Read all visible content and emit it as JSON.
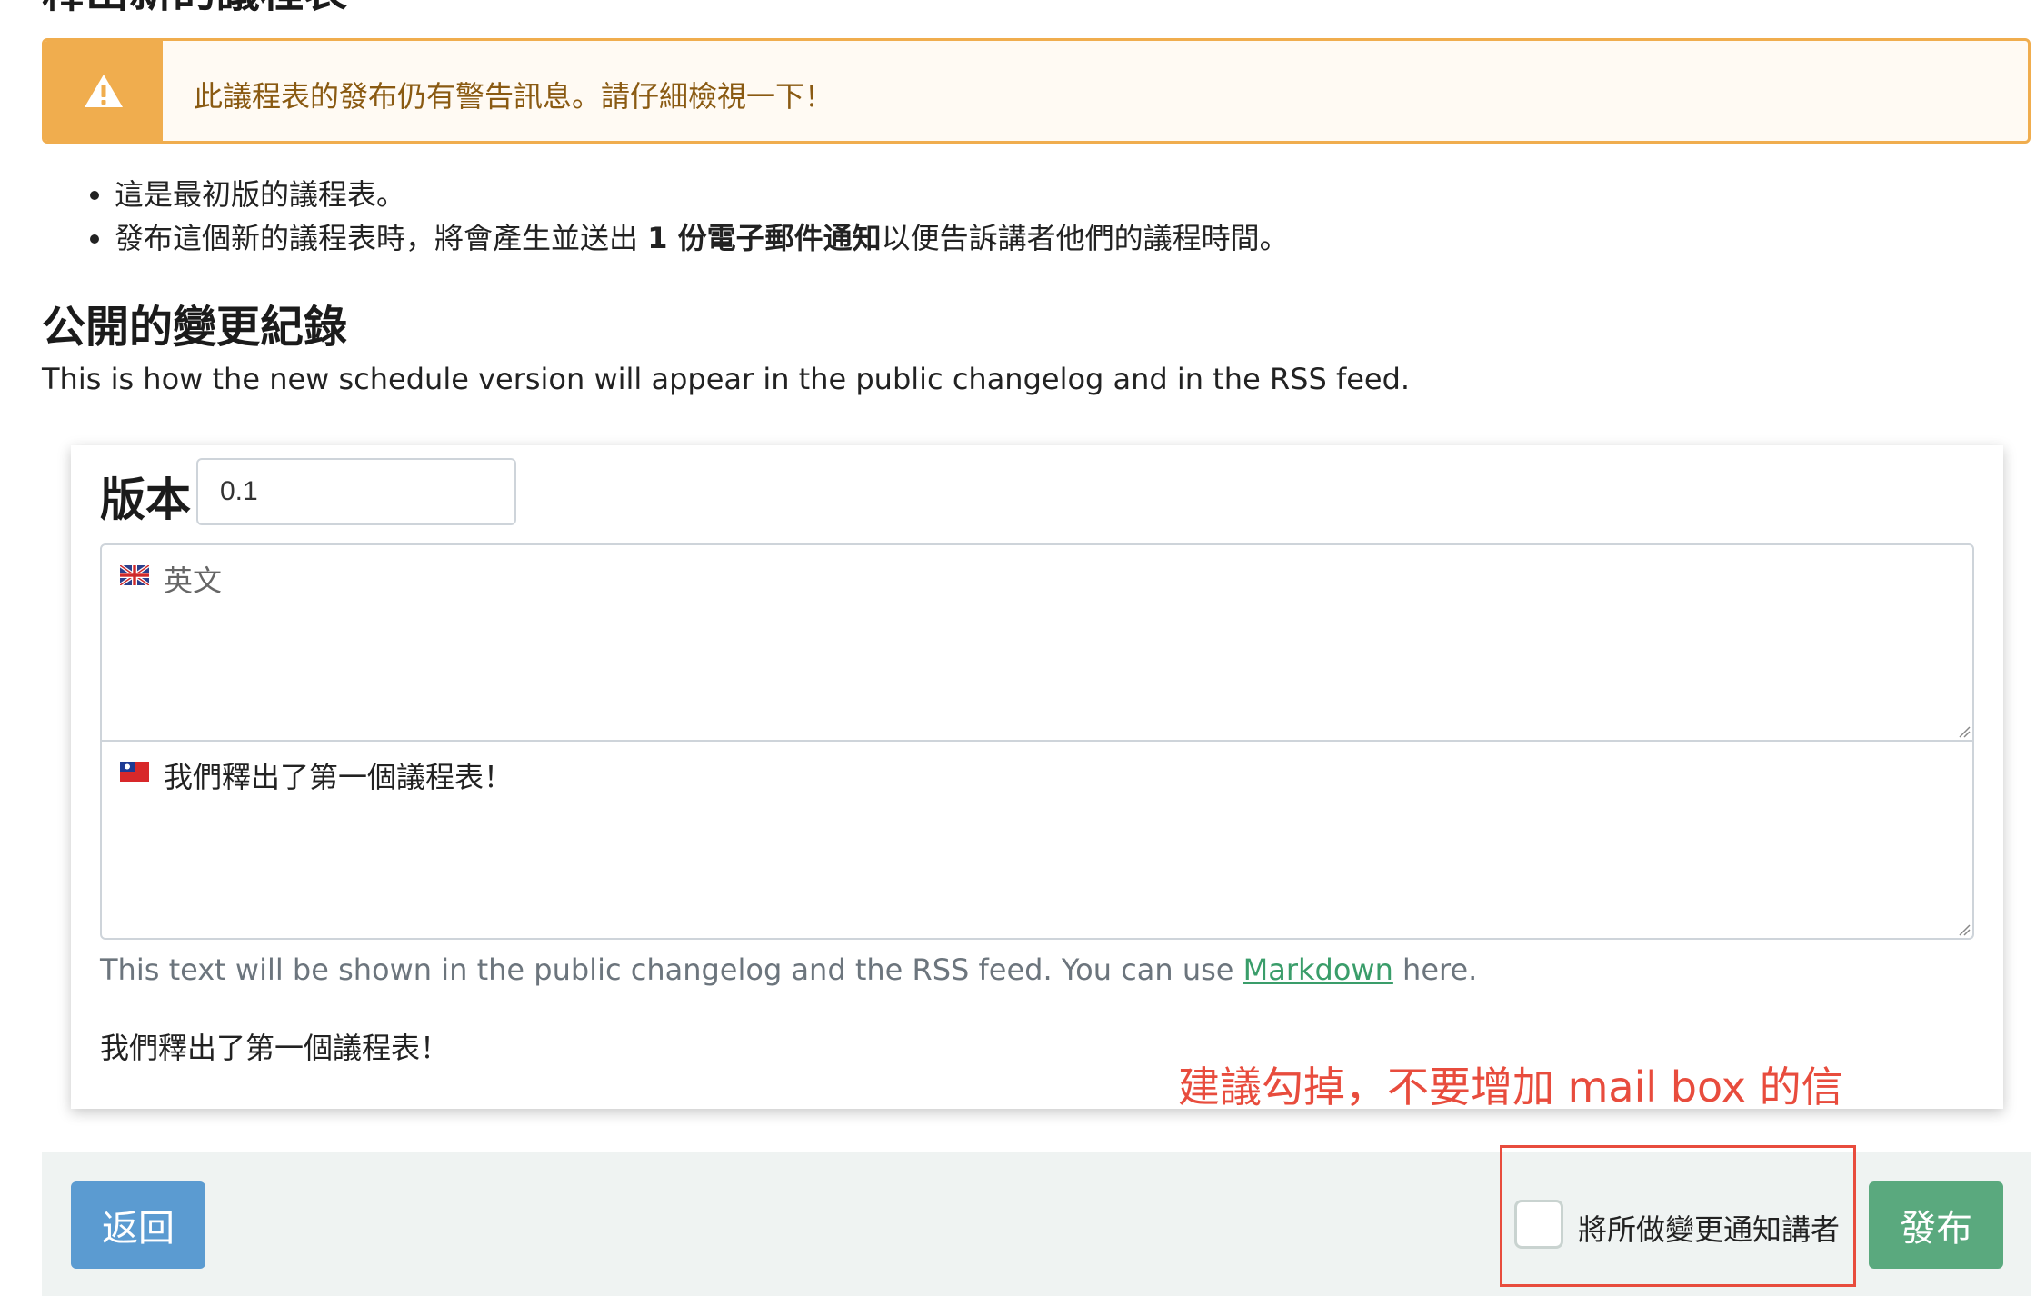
{
  "page": {
    "title": "釋出新的議程表"
  },
  "alert": {
    "icon": "warning-icon",
    "text": "此議程表的發布仍有警告訊息。請仔細檢視一下！",
    "color": "#f0ad4e"
  },
  "bullets": {
    "item1": "這是最初版的議程表。",
    "item2_before": "發布這個新的議程表時，將會產生並送出 ",
    "item2_bold": "1 份電子郵件通知",
    "item2_after": "以便告訴講者他們的議程時間。"
  },
  "changelog": {
    "heading": "公開的變更紀錄",
    "description": "This is how the new schedule version will appear in the public changelog and in the RSS feed."
  },
  "form": {
    "version_label": "版本",
    "version_value": "0.1",
    "textarea_en_placeholder": "英文",
    "textarea_zh_value": "我們釋出了第一個議程表！",
    "help_before": "This text will be shown in the public changelog and the RSS feed. You can use ",
    "help_link": "Markdown",
    "help_after": " here.",
    "preview": "我們釋出了第一個議程表！"
  },
  "annotation": {
    "text": "建議勾掉，不要增加 mail box 的信",
    "color": "#e84c3d"
  },
  "footer": {
    "back_label": "返回",
    "notify_label": "將所做變更通知講者",
    "notify_checked": false,
    "publish_label": "發布",
    "back_color": "#5b9bd1",
    "publish_color": "#5aa97e"
  }
}
